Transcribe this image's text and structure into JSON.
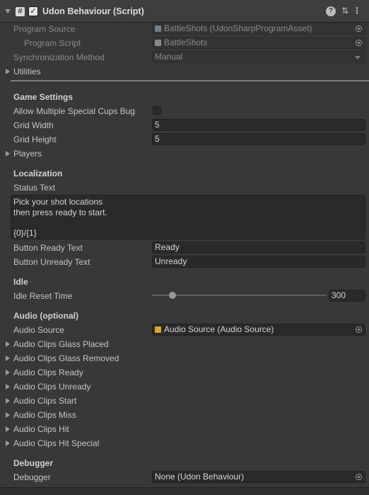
{
  "header": {
    "title": "Udon Behaviour (Script)",
    "script_icon": "#",
    "enabled_check": "✓",
    "help_icon": "?",
    "settings_icon": "⇅",
    "menu_icon": "⋮"
  },
  "program_source": {
    "label": "Program Source",
    "value": "BattleShots (UdonSharpProgramAsset)"
  },
  "program_script": {
    "label": "Program Script",
    "value": "BattleShots"
  },
  "sync_method": {
    "label": "Synchronization Method",
    "value": "Manual"
  },
  "utilities": {
    "label": "Utilities"
  },
  "game_settings": {
    "header": "Game Settings",
    "allow_bug_label": "Allow Multiple Special Cups Bug",
    "allow_bug_value": false,
    "grid_width_label": "Grid Width",
    "grid_width_value": "5",
    "grid_height_label": "Grid Height",
    "grid_height_value": "5",
    "players_label": "Players"
  },
  "localization": {
    "header": "Localization",
    "status_text_label": "Status Text",
    "status_text_value": "Pick your shot locations\nthen press ready to start.\n\n{0}/{1}",
    "button_ready_label": "Button Ready Text",
    "button_ready_value": "Ready",
    "button_unready_label": "Button Unready Text",
    "button_unready_value": "Unready"
  },
  "idle": {
    "header": "Idle",
    "reset_time_label": "Idle Reset Time",
    "reset_time_value": "300",
    "slider_fraction": 0.1
  },
  "audio": {
    "header": "Audio (optional)",
    "source_label": "Audio Source",
    "source_value": "Audio Source (Audio Source)",
    "clips": [
      "Audio Clips Glass Placed",
      "Audio Clips Glass Removed",
      "Audio Clips Ready",
      "Audio Clips Unready",
      "Audio Clips Start",
      "Audio Clips Miss",
      "Audio Clips Hit",
      "Audio Clips Hit Special"
    ]
  },
  "debugger": {
    "header": "Debugger",
    "label": "Debugger",
    "value": "None (Udon Behaviour)"
  },
  "colors": {
    "background": "#383838",
    "field": "#2a2a2a",
    "text": "#c4c4c4",
    "audio_icon": "#e0a52a"
  }
}
